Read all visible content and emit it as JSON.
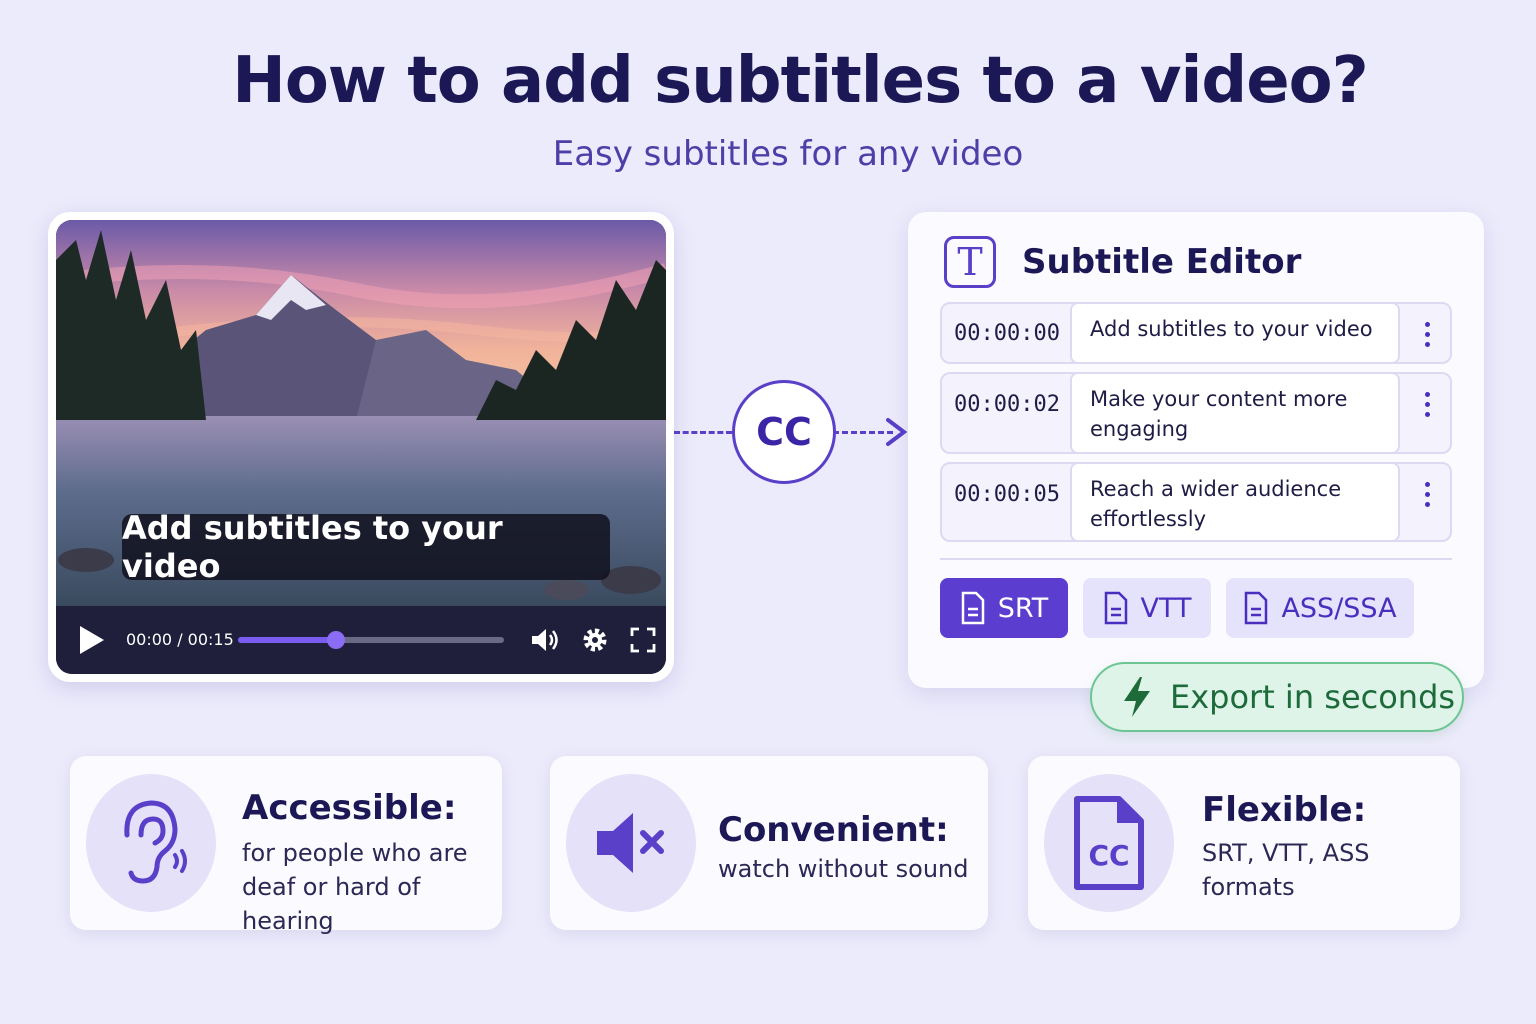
{
  "header": {
    "title": "How to add subtitles to a video?",
    "subtitle": "Easy subtitles for any video"
  },
  "player": {
    "caption": "Add subtitles to your video",
    "time_display": "00:00 / 00:15",
    "progress": 0.37,
    "icons": [
      "play-icon",
      "volume-icon",
      "settings-icon",
      "fullscreen-icon"
    ]
  },
  "connector": {
    "label": "CC"
  },
  "editor": {
    "title": "Subtitle Editor",
    "icon": "text-t-icon",
    "rows": [
      {
        "time": "00:00:00",
        "text": "Add subtitles to your video"
      },
      {
        "time": "00:00:02",
        "text": "Make your content more engaging"
      },
      {
        "time": "00:00:05",
        "text": "Reach a wider audience effortlessly"
      }
    ],
    "formats": [
      {
        "label": "SRT",
        "active": true
      },
      {
        "label": "VTT",
        "active": false
      },
      {
        "label": "ASS/SSA",
        "active": false
      }
    ],
    "export_label": "Export in seconds"
  },
  "features": [
    {
      "title": "Accessible:",
      "desc_line1": "for people who are",
      "desc_line2": "deaf or hard of hearing",
      "icon": "ear-icon"
    },
    {
      "title": "Convenient:",
      "desc_line1": "watch without sound",
      "desc_line2": "",
      "icon": "muted-speaker-icon"
    },
    {
      "title": "Flexible:",
      "desc_line1": "SRT, VTT, ASS",
      "desc_line2": "formats",
      "icon": "cc-file-icon"
    }
  ],
  "colors": {
    "background": "#ecebfb",
    "accent": "#5b3dd0",
    "title": "#1b1855",
    "export_green": "#1d6b3b"
  }
}
